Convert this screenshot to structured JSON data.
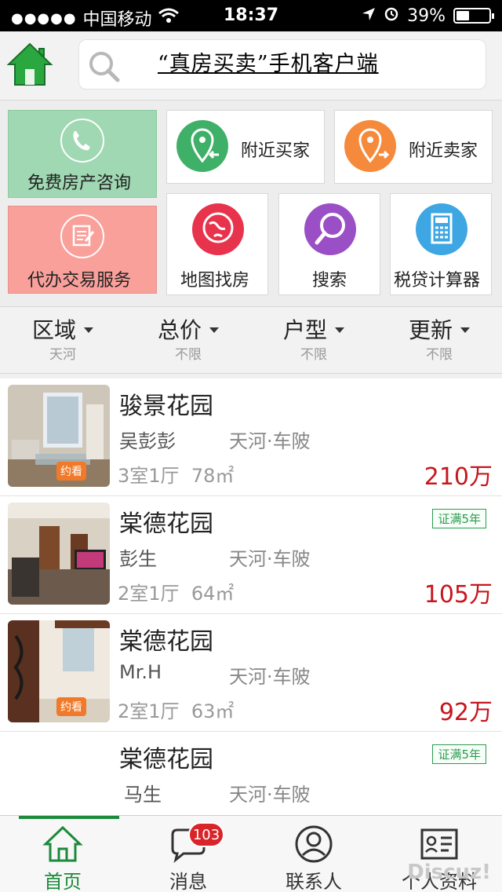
{
  "status_bar": {
    "carrier": "中国移动",
    "time": "18:37",
    "battery_percent": "39%",
    "battery_level": 0.39
  },
  "header": {
    "title": "“真房买卖”手机客户端"
  },
  "tiles": {
    "consult": "免费房产咨询",
    "nearby_buyers": "附近买家",
    "nearby_sellers": "附近卖家",
    "agent_service": "代办交易服务",
    "map_search": "地图找房",
    "search": "搜索",
    "calculator": "税贷计算器"
  },
  "filters": [
    {
      "label": "区域",
      "value": "天河"
    },
    {
      "label": "总价",
      "value": "不限"
    },
    {
      "label": "户型",
      "value": "不限"
    },
    {
      "label": "更新",
      "value": "不限"
    }
  ],
  "listings": [
    {
      "name": "骏景花园",
      "owner": "吴彭彭",
      "area": "天河·车陂",
      "layout": "3室1厅",
      "size": "78㎡",
      "price": "210万",
      "badge": "约看",
      "tag": ""
    },
    {
      "name": "棠德花园",
      "owner": "彭生",
      "area": "天河·车陂",
      "layout": "2室1厅",
      "size": "64㎡",
      "price": "105万",
      "badge": "",
      "tag": "证满5年"
    },
    {
      "name": "棠德花园",
      "owner": "Mr.H",
      "area": "天河·车陂",
      "layout": "2室1厅",
      "size": "63㎡",
      "price": "92万",
      "badge": "约看",
      "tag": ""
    },
    {
      "name": "棠德花园",
      "owner": "马生",
      "area": "天河·车陂",
      "layout": "",
      "size": "",
      "price": "",
      "badge": "",
      "tag": "证满5年"
    }
  ],
  "tabbar": {
    "home": "首页",
    "messages": "消息",
    "messages_count": "103",
    "contacts": "联系人",
    "profile": "个人资料"
  },
  "watermark": "Discuz!",
  "colors": {
    "accent_green": "#1c8a3a",
    "price_red": "#c8161d",
    "consult_tile": "#9fd8b2",
    "service_tile": "#f9a09b"
  }
}
